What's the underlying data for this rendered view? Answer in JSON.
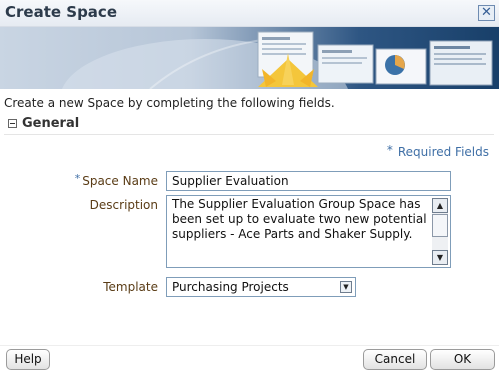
{
  "dialog": {
    "title": "Create Space",
    "close_icon": "close-icon",
    "instruction": "Create a new Space by completing the following fields."
  },
  "section": {
    "label": "General",
    "collapse_icon": "collapse-icon"
  },
  "required": {
    "star": "*",
    "text": "Required Fields"
  },
  "form": {
    "space_name": {
      "star": "*",
      "label": "Space Name",
      "value": "Supplier Evaluation"
    },
    "description": {
      "label": "Description",
      "value": "The Supplier Evaluation Group Space has been set up to evaluate two new potential suppliers - Ace Parts and Shaker Supply."
    },
    "template": {
      "label": "Template",
      "value": "Purchasing Projects"
    }
  },
  "buttons": {
    "help": "Help",
    "cancel": "Cancel",
    "ok": "OK"
  },
  "colors": {
    "label": "#5a3c16",
    "required": "#3f6fa6",
    "banner_dark": "#183f69"
  }
}
